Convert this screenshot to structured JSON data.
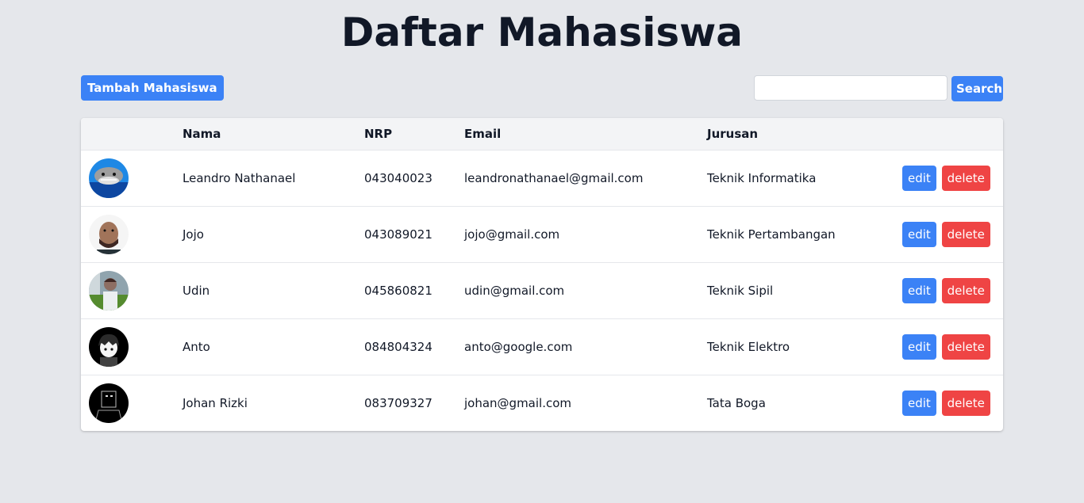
{
  "page": {
    "title": "Daftar Mahasiswa"
  },
  "toolbar": {
    "add_label": "Tambah Mahasiswa",
    "search_value": "",
    "search_label": "Search"
  },
  "table": {
    "headers": {
      "image": "",
      "nama": "Nama",
      "nrp": "NRP",
      "email": "Email",
      "jurusan": "Jurusan",
      "actions": ""
    },
    "rows": [
      {
        "nama": "Leandro Nathanael",
        "nrp": "043040023",
        "email": "leandronathanael@gmail.com",
        "jurusan": "Teknik Informatika",
        "avatar_icon": "shark-avatar-icon",
        "edit_label": "edit",
        "delete_label": "delete"
      },
      {
        "nama": "Jojo",
        "nrp": "043089021",
        "email": "jojo@gmail.com",
        "jurusan": "Teknik Pertambangan",
        "avatar_icon": "person-photo-avatar-icon",
        "edit_label": "edit",
        "delete_label": "delete"
      },
      {
        "nama": "Udin",
        "nrp": "045860821",
        "email": "udin@gmail.com",
        "jurusan": "Teknik Sipil",
        "avatar_icon": "person-outdoor-avatar-icon",
        "edit_label": "edit",
        "delete_label": "delete"
      },
      {
        "nama": "Anto",
        "nrp": "084804324",
        "email": "anto@google.com",
        "jurusan": "Teknik Elektro",
        "avatar_icon": "anime-avatar-icon",
        "edit_label": "edit",
        "delete_label": "delete"
      },
      {
        "nama": "Johan Rizki",
        "nrp": "083709327",
        "email": "johan@gmail.com",
        "jurusan": "Tata Boga",
        "avatar_icon": "dark-figure-avatar-icon",
        "edit_label": "edit",
        "delete_label": "delete"
      }
    ]
  },
  "colors": {
    "primary": "#3b82f6",
    "danger": "#ef4444",
    "background": "#e5e7eb"
  }
}
